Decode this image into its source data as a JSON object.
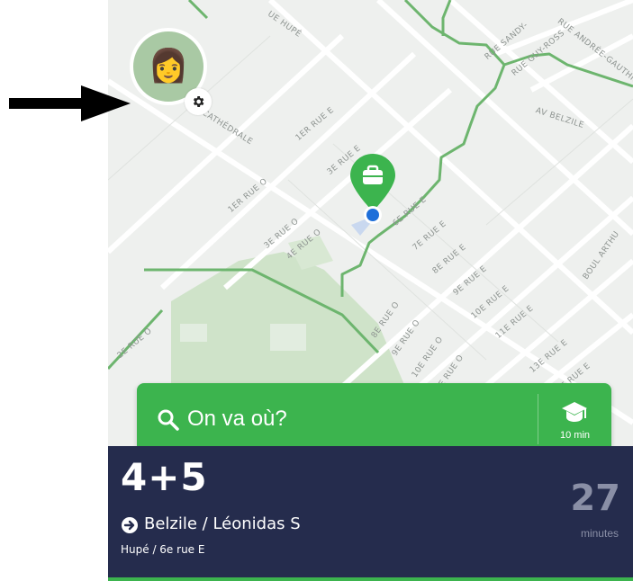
{
  "map": {
    "streets": {
      "hupe_top": "UE HUPÉ",
      "cathedrale": "CATHÉDRALE",
      "rue_1er_e": "1ER RUE E",
      "rue_3e_e": "3E RUE E",
      "rue_1er_o": "1ER RUE O",
      "rue_3e_o": "3E RUE O",
      "rue_4e_o": "4E RUE O",
      "rue_6e_e": "6E RUE E",
      "rue_7e_e": "7E RUE E",
      "rue_8e_e": "8E RUE E",
      "rue_9e_e": "9E RUE E",
      "rue_10e_e": "10E RUE E",
      "rue_11e_e": "11E RUE E",
      "rue_8e_o": "8E RUE O",
      "rue_9e_o": "9E RUE O",
      "rue_10e_o": "10E RUE O",
      "rue_11e_o": "E RUE O",
      "rue_13e_e": "13E RUE E",
      "rue_14e_e": "4E RUE E",
      "rue_2e_o": "2E RUE O",
      "sandy": "RUE SANDY-",
      "guy_ross": "RUE GUY-ROSS",
      "andree": "RUE ANDRÉE-GAUTHIER",
      "belzile": "AV BELZILE",
      "boul_arthur": "BOUL ARTHU"
    },
    "colors": {
      "route": "#6db56e",
      "park": "#cfe3c9",
      "pin": "#3cb44e",
      "location": "#1e6fd9"
    }
  },
  "avatar": {
    "emoji": "👩",
    "settings_icon": "gear-icon"
  },
  "search": {
    "placeholder": "On va où?",
    "school_time": "10 min"
  },
  "trip": {
    "route": "4+5",
    "direction": "Belzile / Léonidas S",
    "stop": "Hupé / 6e rue E",
    "minutes": "27",
    "minutes_label": "minutes"
  }
}
